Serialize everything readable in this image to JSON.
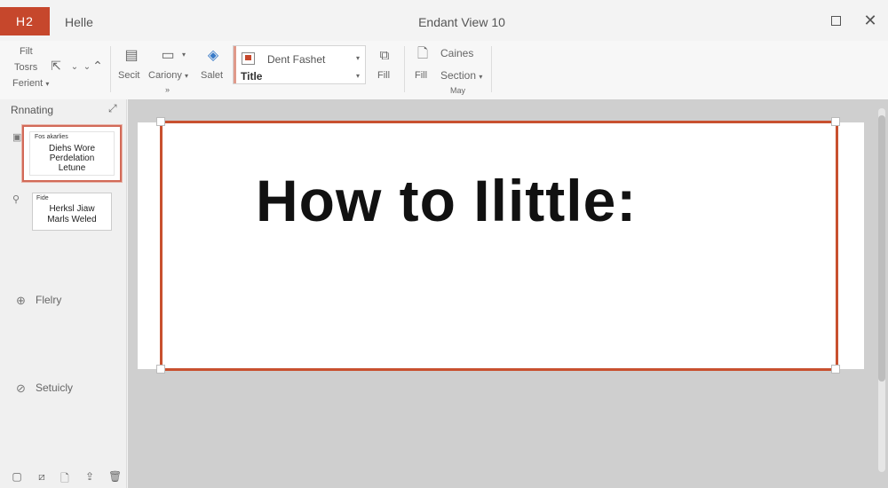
{
  "titlebar": {
    "app_badge": "H2",
    "tab": "Helle",
    "window_title": "Endant View 10",
    "maximize_icon": "maximize-icon",
    "close_icon": "close-icon"
  },
  "ribbon": {
    "left_group": {
      "row1": "Filt",
      "row2": "Tosrs",
      "row3": "Ferient",
      "row3_chev": "▾"
    },
    "buttons": {
      "secit": "Secit",
      "cariony": "Cariony",
      "salet": "Salet",
      "fill": "Fill",
      "fill2": "Fill",
      "caines": "Caines",
      "section": "Section"
    },
    "style_box": {
      "font": "Dent Fashet",
      "style": "Title"
    },
    "group_label_1": "»",
    "group_label_2": "May"
  },
  "panel": {
    "title": "Rnnating",
    "slides": [
      {
        "head": "Fos akarlies",
        "body": [
          "Diehs Wore",
          "Perdelation",
          "Letune"
        ]
      },
      {
        "head": "Fide",
        "body": [
          "Herksl Jiaw",
          "Marls Weled"
        ]
      }
    ],
    "sections": [
      "Flelry",
      "Setuicly"
    ]
  },
  "slide": {
    "title": "How to Ilittle:"
  },
  "colors": {
    "accent": "#c6472c",
    "frame": "#c8502f",
    "workspace": "#cfcfcf"
  }
}
